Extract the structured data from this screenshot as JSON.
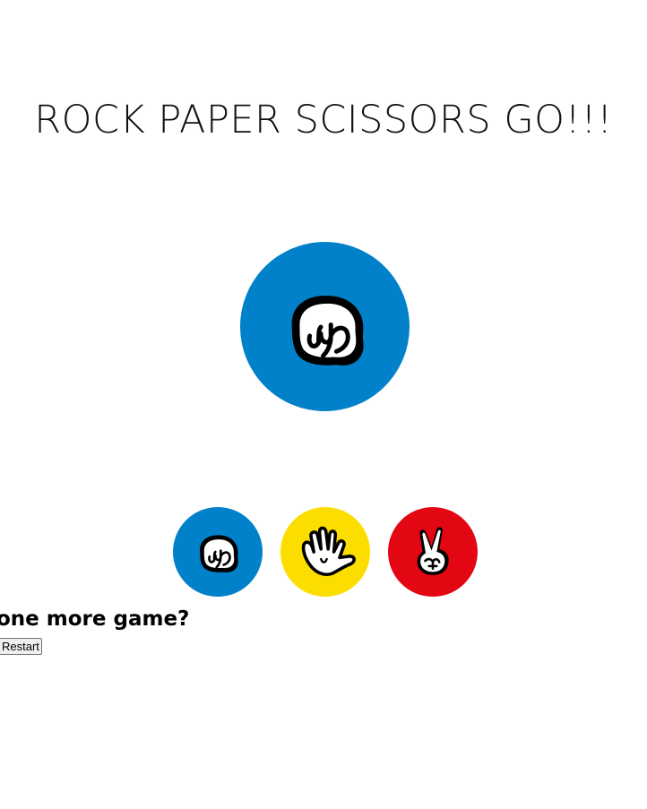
{
  "game": {
    "title": "ROCK PAPER SCISSORS GO!!!",
    "current_choice": "rock",
    "current_choice_icon": "rock-fist-icon",
    "current_choice_color": "#0081c9"
  },
  "options": [
    {
      "name": "rock",
      "icon": "rock-fist-icon",
      "color": "#0081c9"
    },
    {
      "name": "paper",
      "icon": "paper-open-hand-icon",
      "color": "#fbde00"
    },
    {
      "name": "scissors",
      "icon": "scissors-peace-hand-icon",
      "color": "#e30613"
    }
  ],
  "footer": {
    "prompt": "one more game?",
    "restart_label": "Restart"
  }
}
